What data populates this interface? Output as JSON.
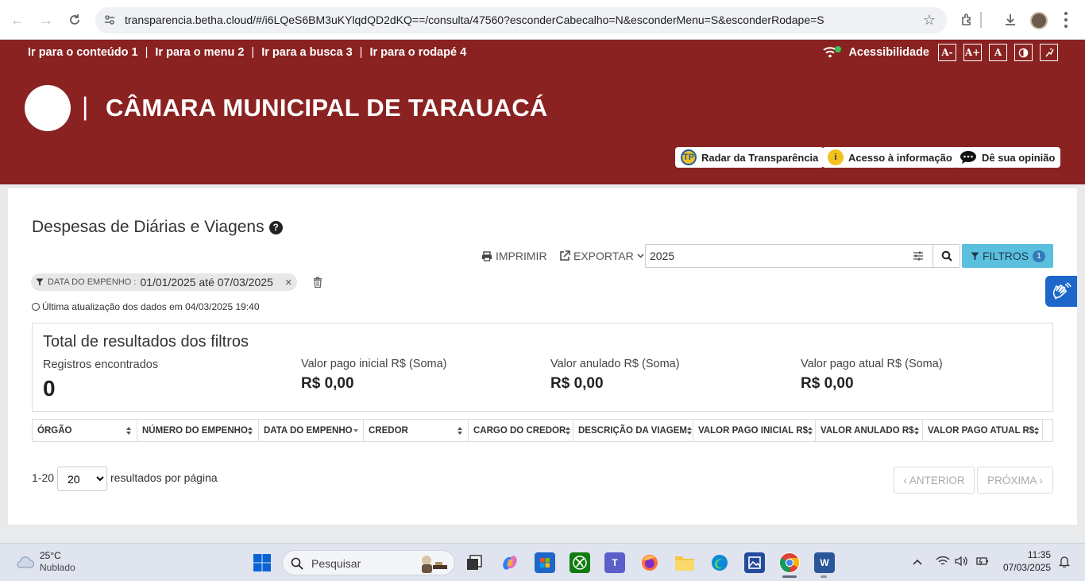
{
  "browser": {
    "url": "transparencia.betha.cloud/#/i6LQeS6BM3uKYlqdQD2dKQ==/consulta/47560?esconderCabecalho=N&esconderMenu=S&esconderRodape=S"
  },
  "header": {
    "skip_links": [
      {
        "label": "Ir para o conteúdo",
        "key": "1"
      },
      {
        "label": "Ir para o menu",
        "key": "2"
      },
      {
        "label": "Ir para a busca",
        "key": "3"
      },
      {
        "label": "Ir para o rodapé",
        "key": "4"
      }
    ],
    "accessibility_label": "Acessibilidade",
    "font_decrease": "A-",
    "font_increase": "A+",
    "font_reset": "A",
    "site_title_separator": "|",
    "site_title": "CÂMARA MUNICIPAL DE TARAUACÁ",
    "quick_links": {
      "radar": "Radar da Transparência",
      "radar_icon_text": "TP",
      "acesso": "Acesso à informação",
      "acesso_icon_text": "i",
      "opiniao": "Dê sua opinião"
    }
  },
  "main": {
    "title": "Despesas de Diárias e Viagens",
    "help_glyph": "?",
    "print_label": "IMPRIMIR",
    "export_label": "EXPORTAR",
    "search_value": "2025",
    "filters_label": "FILTROS",
    "filters_count": "1",
    "active_filter": {
      "label": "DATA DO EMPENHO :",
      "value": "01/01/2025 até 07/03/2025",
      "remove_glyph": "×"
    },
    "last_update": "Última atualização dos dados em 04/03/2025 19:40",
    "totals": {
      "title": "Total de resultados dos filtros",
      "records_label": "Registros encontrados",
      "records_value": "0",
      "paid_initial_label": "Valor pago inicial R$ (Soma)",
      "paid_initial_value": "R$ 0,00",
      "annulled_label": "Valor anulado R$ (Soma)",
      "annulled_value": "R$ 0,00",
      "paid_current_label": "Valor pago atual R$ (Soma)",
      "paid_current_value": "R$ 0,00"
    },
    "columns": [
      "ÓRGÃO",
      "NÚMERO DO EMPENHO",
      "DATA DO EMPENHO",
      "CREDOR",
      "CARGO DO CREDOR",
      "DESCRIÇÃO DA VIAGEM",
      "VALOR PAGO INICIAL R$",
      "VALOR ANULADO R$",
      "VALOR PAGO ATUAL R$"
    ],
    "pager": {
      "range": "1-20",
      "page_size": "20",
      "page_size_options": [
        "20"
      ],
      "suffix": "resultados por página",
      "prev": "‹ ANTERIOR",
      "next": "PRÓXIMA ›"
    }
  },
  "taskbar": {
    "temperature": "25°C",
    "condition": "Nublado",
    "search_placeholder": "Pesquisar",
    "time": "11:35",
    "date": "07/03/2025"
  },
  "colors": {
    "header_bg": "#8a2221",
    "filters_btn": "#5bc0de",
    "vlibras": "#1c67c9"
  }
}
